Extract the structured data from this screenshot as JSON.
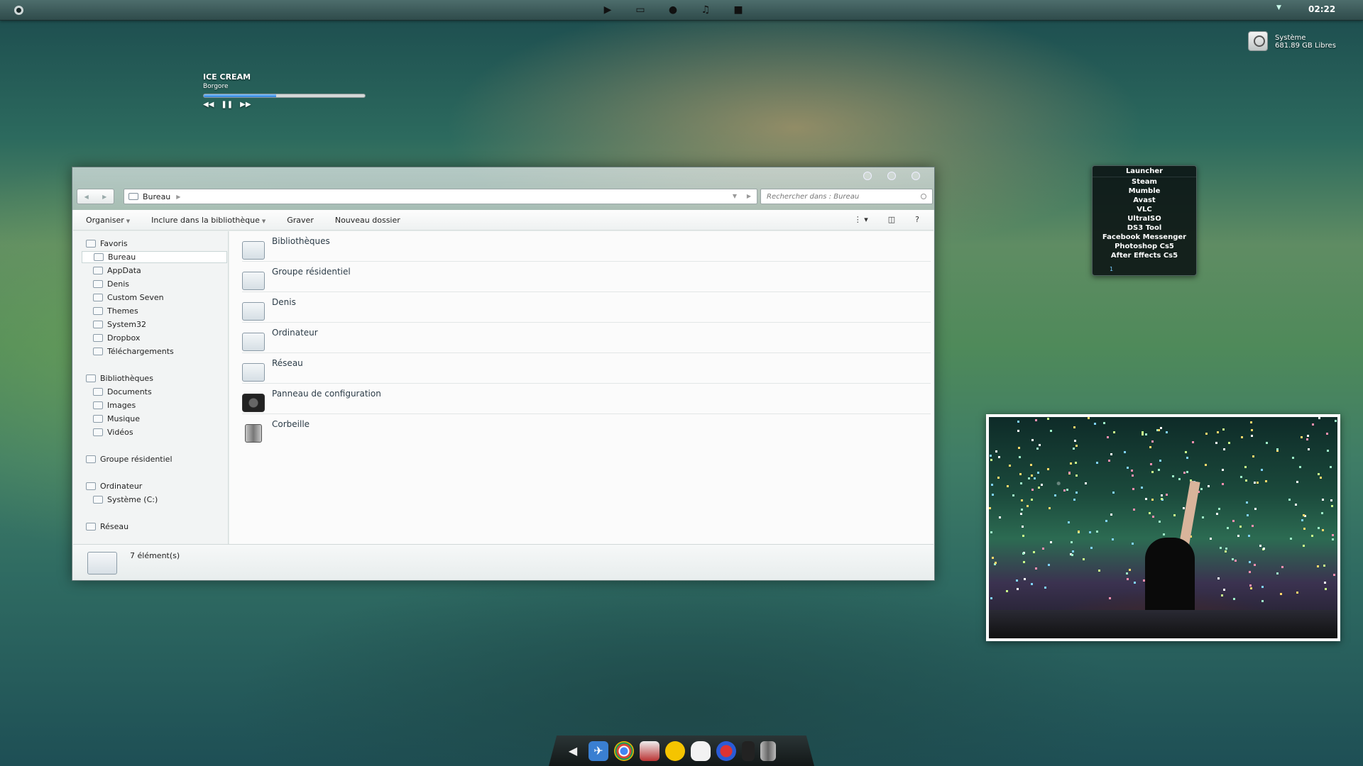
{
  "topbar": {
    "clock": "02:22",
    "icons": [
      "play-icon",
      "folder-icon",
      "firefox-icon",
      "music-icon",
      "chat-icon"
    ]
  },
  "disk": {
    "name": "Système",
    "free": "681.89 GB  Libres"
  },
  "player": {
    "title": "ICE CREAM",
    "artist": "Borgore",
    "progress": 0.45
  },
  "explorer": {
    "address": "Bureau",
    "search_placeholder": "Rechercher dans : Bureau",
    "toolbar": {
      "organize": "Organiser",
      "include": "Inclure dans la bibliothèque",
      "burn": "Graver",
      "new_folder": "Nouveau dossier",
      "help": "?"
    },
    "sidebar": {
      "favorites": "Favoris",
      "favorite_items": [
        "Bureau",
        "AppData",
        "Denis",
        "Custom Seven",
        "Themes",
        "System32",
        "Dropbox",
        "Téléchargements"
      ],
      "libraries": "Bibliothèques",
      "library_items": [
        "Documents",
        "Images",
        "Musique",
        "Vidéos"
      ],
      "homegroup": "Groupe résidentiel",
      "computer": "Ordinateur",
      "computer_items": [
        "Système (C:)"
      ],
      "network": "Réseau"
    },
    "items": [
      "Bibliothèques",
      "Groupe résidentiel",
      "Denis",
      "Ordinateur",
      "Réseau",
      "Panneau de configuration",
      "Corbeille"
    ],
    "status": "7 élément(s)"
  },
  "launcher": {
    "title": "Launcher",
    "items": [
      "Steam",
      "Mumble",
      "Avast",
      "VLC",
      "UltraISO",
      "DS3 Tool",
      "Facebook Messenger",
      "Photoshop Cs5",
      "After Effects Cs5"
    ],
    "page": "1"
  },
  "dock": {
    "apps": [
      "telegram-icon",
      "xcode-icon",
      "chrome-icon",
      "package-icon",
      "duck-icon",
      "stormtrooper-icon",
      "superman-icon",
      "terminal-icon",
      "trash-icon"
    ]
  }
}
